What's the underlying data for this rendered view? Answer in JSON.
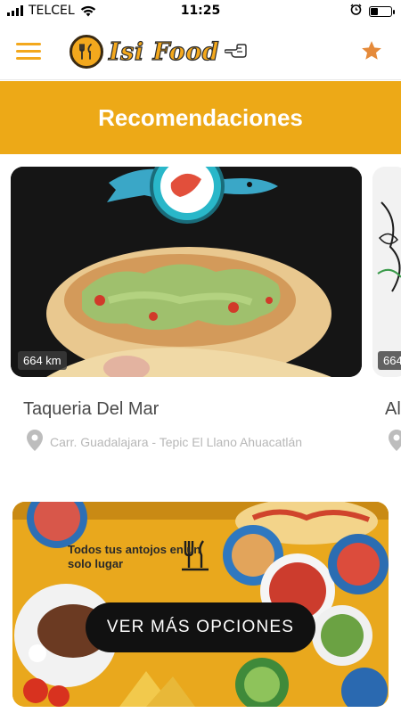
{
  "status_bar": {
    "carrier": "TELCEL",
    "time": "11:25",
    "battery_level": 0.35
  },
  "app_bar": {
    "logo_text": "Isi Food",
    "menu_icon": "hamburger-menu-icon",
    "favorites_icon": "star-icon",
    "accent_color": "#F3A81D"
  },
  "section": {
    "title": "Recomendaciones",
    "banner_color": "#EDA917"
  },
  "cards": [
    {
      "name": "Taqueria Del Mar",
      "distance": "664 km",
      "address": "Carr. Guadalajara - Tepic El Llano Ahuacatlán"
    },
    {
      "name": "Al",
      "distance": "664"
    }
  ],
  "promo": {
    "caption": "Todos tus antojos en un solo lugar",
    "button_label": "VER MÁS OPCIONES"
  }
}
